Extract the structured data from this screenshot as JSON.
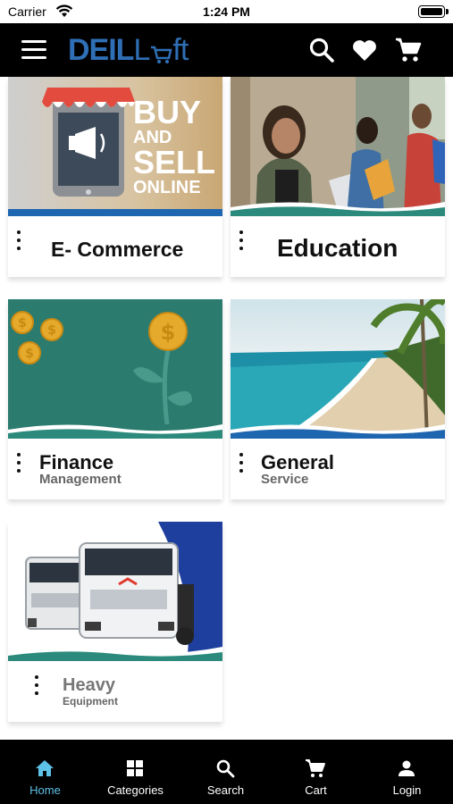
{
  "status_bar": {
    "carrier": "Carrier",
    "time": "1:24 PM"
  },
  "header": {
    "logo_part1": "DEIL",
    "logo_part2": "L",
    "logo_part3": "ft",
    "icons": [
      "menu-icon",
      "search-icon",
      "heart-icon",
      "cart-icon"
    ]
  },
  "cards": [
    {
      "title": "E- Commerce",
      "image_text": [
        "BUY",
        "AND",
        "SELL",
        "ONLINE"
      ]
    },
    {
      "title": "Education"
    },
    {
      "title": "Finance",
      "subtitle": "Management"
    },
    {
      "title": "General",
      "subtitle": "Service"
    },
    {
      "title": "Heavy",
      "subtitle": "Equipment"
    }
  ],
  "bottom_nav": [
    {
      "label": "Home",
      "icon": "home-icon",
      "active": true
    },
    {
      "label": "Categories",
      "icon": "grid-icon",
      "active": false
    },
    {
      "label": "Search",
      "icon": "search-icon",
      "active": false
    },
    {
      "label": "Cart",
      "icon": "cart-icon",
      "active": false
    },
    {
      "label": "Login",
      "icon": "user-icon",
      "active": false
    }
  ],
  "colors": {
    "header_bg": "#000000",
    "logo_blue": "#2f6fb6",
    "nav_active": "#5ec1e6",
    "finance_teal": "#2b7b6f",
    "ocean": "#2aa8b8"
  }
}
